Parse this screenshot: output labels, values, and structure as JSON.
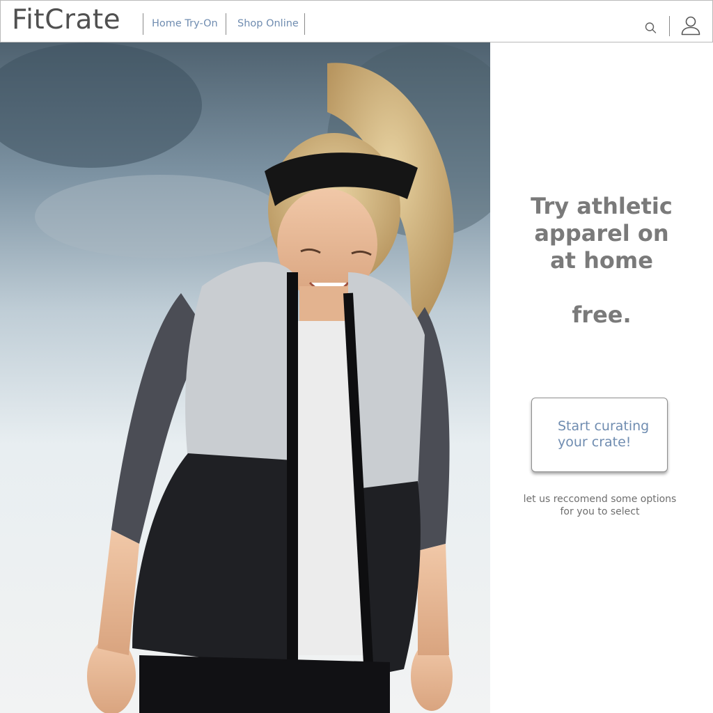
{
  "header": {
    "logo": "FitCrate",
    "nav": [
      {
        "label": "Home Try-On"
      },
      {
        "label": "Shop Online"
      }
    ],
    "icons": {
      "search": "search-icon",
      "account": "user-icon"
    }
  },
  "hero": {
    "image": "photo-woman-athletic-vest-headband-snow"
  },
  "panel": {
    "headline_lines": [
      "Try athletic",
      "apparel on",
      "at home"
    ],
    "headline_emphasis": "free.",
    "cta_label": "Start curating your crate!",
    "subnote": "let us reccomend some options for you to select"
  },
  "colors": {
    "logo": "#505050",
    "link": "#6f8cb0",
    "headline": "#7a7a7a",
    "border": "#b9b9b9"
  }
}
